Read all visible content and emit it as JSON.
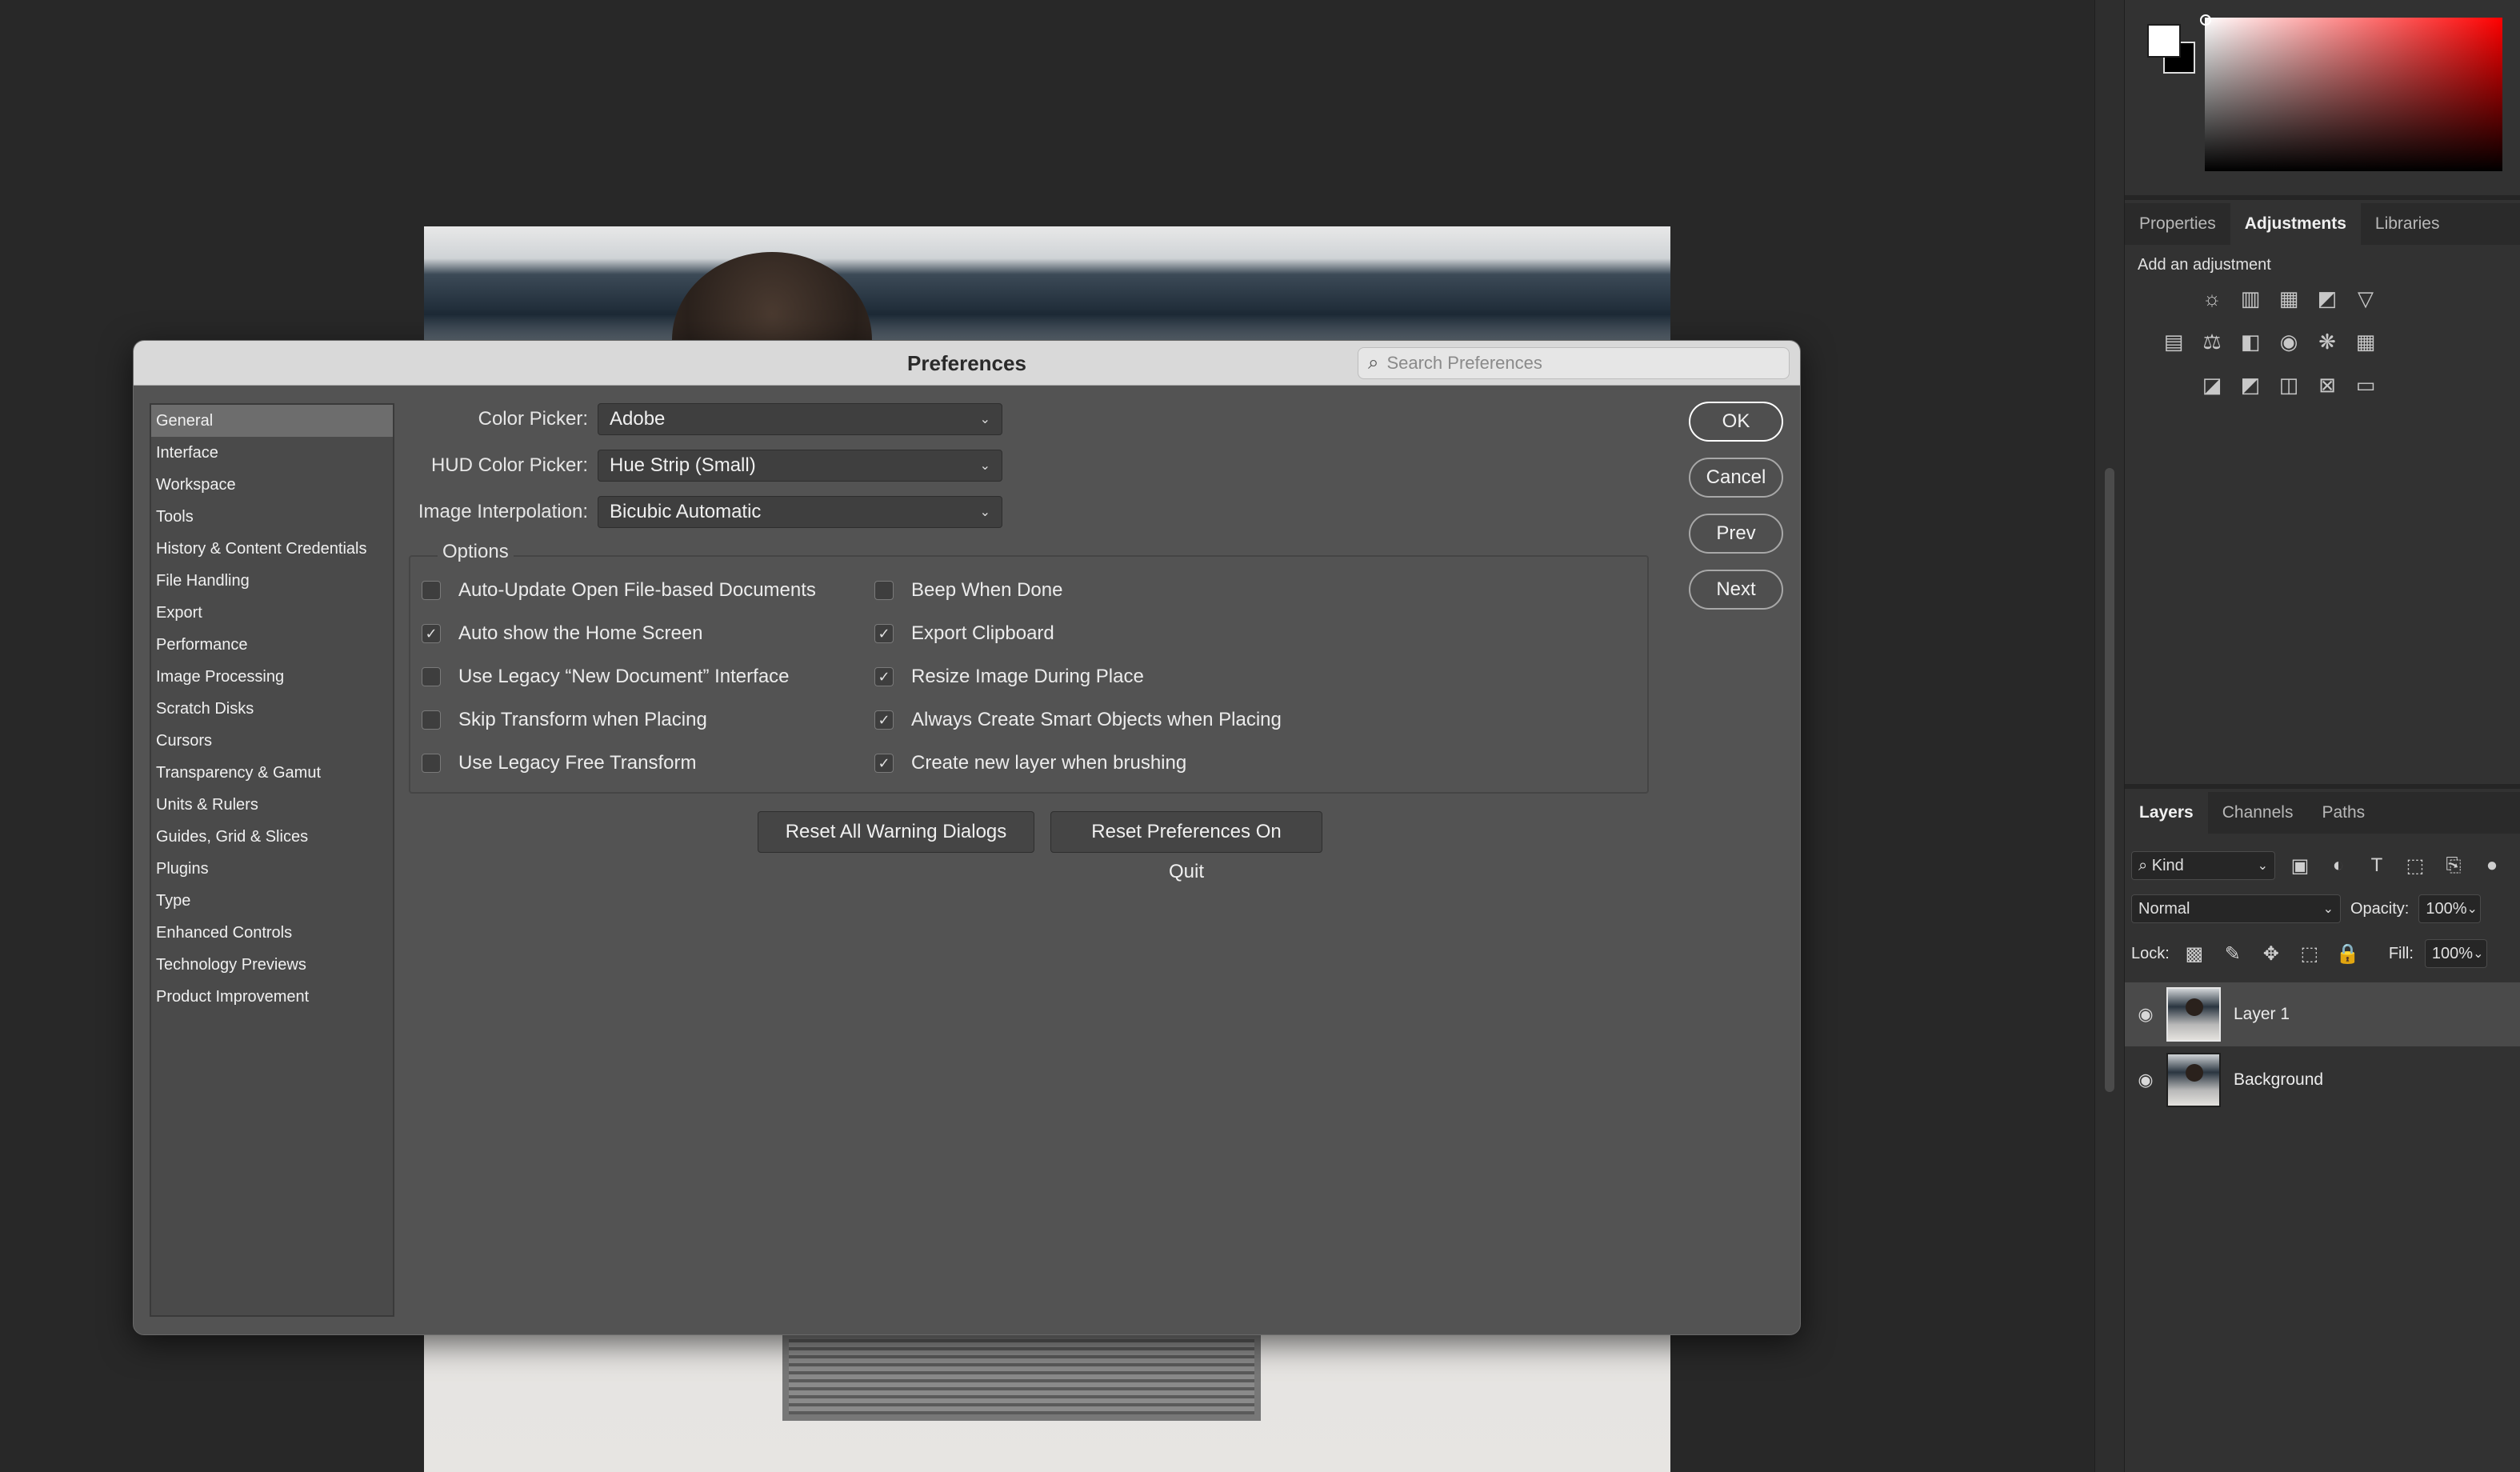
{
  "dialog": {
    "title": "Preferences",
    "search_placeholder": "Search Preferences",
    "categories": [
      "General",
      "Interface",
      "Workspace",
      "Tools",
      "History & Content Credentials",
      "File Handling",
      "Export",
      "Performance",
      "Image Processing",
      "Scratch Disks",
      "Cursors",
      "Transparency & Gamut",
      "Units & Rulers",
      "Guides, Grid & Slices",
      "Plugins",
      "Type",
      "Enhanced Controls",
      "Technology Previews",
      "Product Improvement"
    ],
    "selected_category": "General",
    "fields": {
      "color_picker": {
        "label": "Color Picker:",
        "value": "Adobe"
      },
      "hud_color_picker": {
        "label": "HUD Color Picker:",
        "value": "Hue Strip (Small)"
      },
      "image_interpolation": {
        "label": "Image Interpolation:",
        "value": "Bicubic Automatic"
      }
    },
    "options_title": "Options",
    "options_left": [
      {
        "label": "Auto-Update Open File-based Documents",
        "checked": false
      },
      {
        "label": "Auto show the Home Screen",
        "checked": true
      },
      {
        "label": "Use Legacy “New Document” Interface",
        "checked": false
      },
      {
        "label": "Skip Transform when Placing",
        "checked": false
      },
      {
        "label": "Use Legacy Free Transform",
        "checked": false
      }
    ],
    "options_right": [
      {
        "label": "Beep When Done",
        "checked": false
      },
      {
        "label": "Export Clipboard",
        "checked": true
      },
      {
        "label": "Resize Image During Place",
        "checked": true
      },
      {
        "label": "Always Create Smart Objects when Placing",
        "checked": true
      },
      {
        "label": "Create new layer when brushing",
        "checked": true
      }
    ],
    "reset_warnings_label": "Reset All Warning Dialogs",
    "reset_prefs_label": "Reset Preferences On Quit",
    "buttons": {
      "ok": "OK",
      "cancel": "Cancel",
      "prev": "Prev",
      "next": "Next"
    }
  },
  "panels": {
    "props_tabs": [
      "Properties",
      "Adjustments",
      "Libraries"
    ],
    "props_active": "Adjustments",
    "add_adjustment_label": "Add an adjustment",
    "layers_tabs": [
      "Layers",
      "Channels",
      "Paths"
    ],
    "layers_active": "Layers",
    "kind_filter": "Kind",
    "blend_mode": "Normal",
    "opacity_label": "Opacity:",
    "opacity_value": "100%",
    "lock_label": "Lock:",
    "fill_label": "Fill:",
    "fill_value": "100%",
    "layers": [
      {
        "name": "Layer 1",
        "selected": true
      },
      {
        "name": "Background",
        "selected": false
      }
    ]
  },
  "colors": {
    "foreground": "#ffffff",
    "background": "#000000",
    "picker_hue": "#ff0000"
  }
}
